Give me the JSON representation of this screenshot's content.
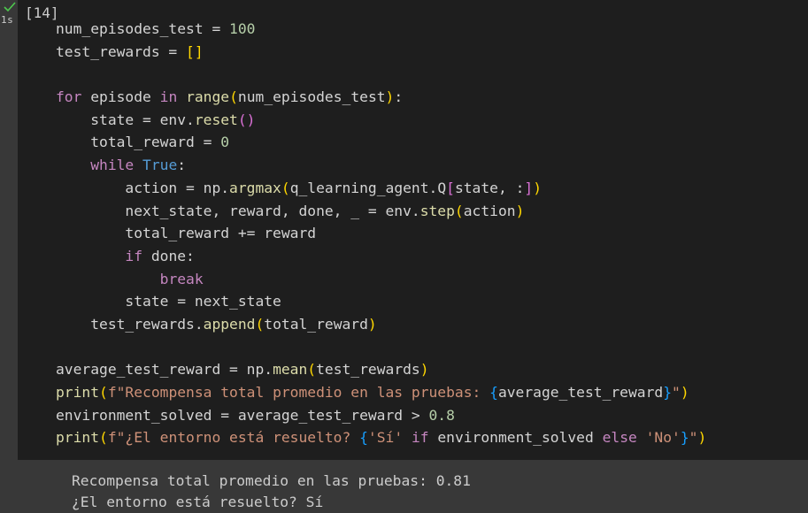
{
  "cell": {
    "execution_count": "[14]",
    "timing": "1s",
    "status": "success"
  },
  "code": {
    "l1": {
      "a": "num_episodes_test = ",
      "b": "100"
    },
    "l2": {
      "a": "test_rewards = ",
      "b": "[]"
    },
    "l4": {
      "kw": "for",
      "a": " episode ",
      "kw2": "in",
      "sp": " ",
      "fn": "range",
      "o": "(",
      "arg": "num_episodes_test",
      "c": ")",
      "end": ":"
    },
    "l5": {
      "a": "    state = env.",
      "fn": "reset",
      "o": "()"
    },
    "l6": {
      "a": "    total_reward = ",
      "num": "0"
    },
    "l7": {
      "ind": "    ",
      "kw": "while",
      "sp": " ",
      "kw2": "True",
      "end": ":"
    },
    "l8": {
      "a": "        action = np.",
      "fn": "argmax",
      "o": "(",
      "b": "q_learning_agent.Q",
      "o2": "[",
      "c": "state, :",
      "c2": "]",
      "c3": ")"
    },
    "l9": {
      "a": "        next_state, reward, done, _ = env.",
      "fn": "step",
      "o": "(",
      "b": "action",
      "c": ")"
    },
    "l10": {
      "a": "        total_reward += reward"
    },
    "l11": {
      "ind": "        ",
      "kw": "if",
      "a": " done:"
    },
    "l12": {
      "ind": "            ",
      "kw": "break"
    },
    "l13": {
      "a": "        state = next_state"
    },
    "l14": {
      "a": "    test_rewards.",
      "fn": "append",
      "o": "(",
      "b": "total_reward",
      "c": ")"
    },
    "l16": {
      "a": "average_test_reward = np.",
      "fn": "mean",
      "o": "(",
      "b": "test_rewards",
      "c": ")"
    },
    "l17": {
      "fn": "print",
      "o": "(",
      "s1": "f\"Recompensa total promedio en las pruebas: ",
      "b1": "{",
      "v": "average_test_reward",
      "b2": "}",
      "s2": "\"",
      "c": ")"
    },
    "l18": {
      "a": "environment_solved = average_test_reward > ",
      "num": "0.8"
    },
    "l19": {
      "fn": "print",
      "o": "(",
      "s1": "f\"¿El entorno está resuelto? ",
      "b1": "{",
      "s3": "'Sí'",
      "sp1": " ",
      "kw": "if",
      "v": " environment_solved ",
      "kw2": "else",
      "sp2": " ",
      "s4": "'No'",
      "b2": "}",
      "s2": "\"",
      "c": ")"
    }
  },
  "output": {
    "line1": "Recompensa total promedio en las pruebas: 0.81",
    "line2": "¿El entorno está resuelto? Sí"
  }
}
